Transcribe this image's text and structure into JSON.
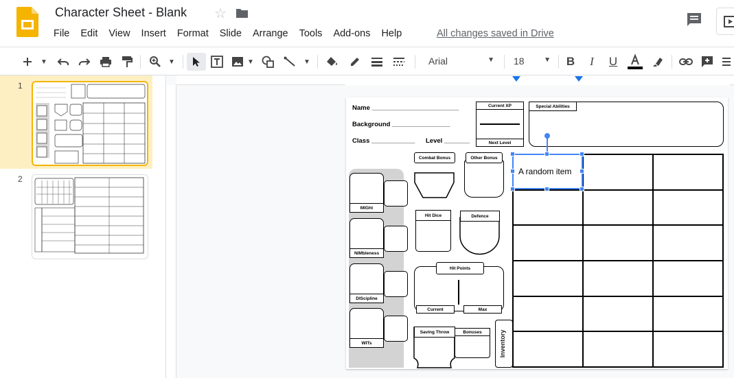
{
  "header": {
    "title": "Character Sheet - Blank",
    "saved_status": "All changes saved in Drive",
    "menu": [
      "File",
      "Edit",
      "View",
      "Insert",
      "Format",
      "Slide",
      "Arrange",
      "Tools",
      "Add-ons",
      "Help"
    ]
  },
  "toolbar": {
    "font": "Arial",
    "font_size": "18"
  },
  "filmstrip": {
    "slides": [
      {
        "number": "1"
      },
      {
        "number": "2"
      }
    ]
  },
  "slide": {
    "name_label": "Name ________________________",
    "background_label": "Background ________________",
    "class_label": "Class ____________",
    "level_label": "Level _______",
    "current_xp": "Current XP",
    "next_level": "Next Level",
    "special_abilities": "Special Abilities",
    "combat_bonus": "Combat Bonus",
    "other_bonus": "Other Bonus",
    "hit_dice": "Hit Dice",
    "defence": "Defence",
    "hit_points": "Hit Points",
    "current": "Current",
    "max": "Max",
    "saving_throw": "Saving Throw",
    "bonuses": "Bonuses",
    "inventory": "Inventory",
    "stats": [
      "MIGht",
      "NIMbleness",
      "DIScipline",
      "WITs"
    ],
    "selected_text": "A random item"
  },
  "colors": {
    "selection": "#4285f4",
    "slide_highlight": "#feefc3",
    "slide_border": "#f4b400",
    "logo": "#f4b400"
  }
}
